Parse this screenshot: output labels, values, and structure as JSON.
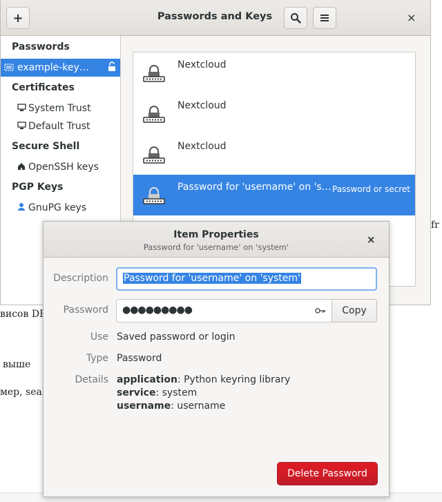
{
  "window": {
    "title": "Passwords and Keys",
    "add_label": "+",
    "search_glyph": "🔍",
    "menu_glyph": "≡",
    "close_glyph": "×"
  },
  "sidebar": {
    "passwords_title": "Passwords",
    "keyring_item": "example-key…",
    "certificates_title": "Certificates",
    "system_trust": "System Trust",
    "default_trust": "Default Trust",
    "secure_shell_title": "Secure Shell",
    "openssh_keys": "OpenSSH keys",
    "pgp_title": "PGP Keys",
    "gnupg_keys": "GnuPG keys"
  },
  "list": {
    "items": [
      {
        "label": "Nextcloud"
      },
      {
        "label": "Nextcloud"
      },
      {
        "label": "Nextcloud"
      },
      {
        "label": "Password for 'username' on 's…",
        "subtitle": "Password or secret"
      }
    ]
  },
  "background": {
    "text_fr": "fr",
    "text_dbus": "висов DB",
    "text_above": "выше",
    "text_seaho": "мер, seaho"
  },
  "dialog": {
    "title": "Item Properties",
    "subtitle": "Password for 'username' on 'system'",
    "close_glyph": "×",
    "description_label": "Description",
    "description_value": "Password for 'username' on 'system'",
    "password_label": "Password",
    "password_value": "●●●●●●●●●",
    "copy_label": "Copy",
    "use_label": "Use",
    "use_value": "Saved password or login",
    "type_label": "Type",
    "type_value": "Password",
    "details_label": "Details",
    "details": [
      {
        "key": "application",
        "value": ": Python keyring library"
      },
      {
        "key": "service",
        "value": ": system"
      },
      {
        "key": "username",
        "value": ": username"
      }
    ],
    "delete_label": "Delete Password"
  },
  "colors": {
    "accent": "#3584e4",
    "destructive": "#e01b24"
  }
}
